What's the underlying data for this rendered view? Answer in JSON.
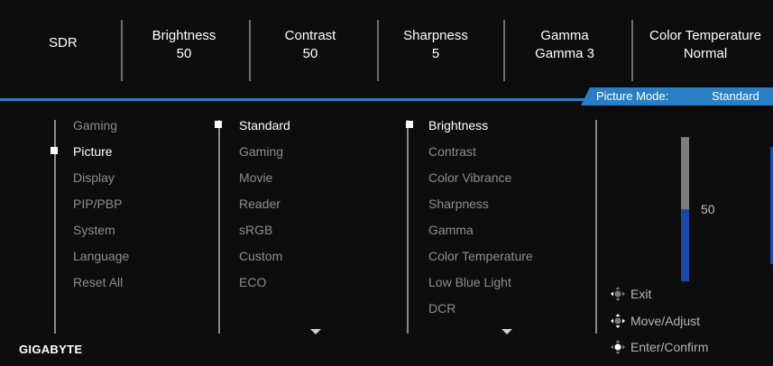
{
  "status_bar": {
    "hdr_mode": "SDR",
    "brightness": {
      "label": "Brightness",
      "value": "50"
    },
    "contrast": {
      "label": "Contrast",
      "value": "50"
    },
    "sharpness": {
      "label": "Sharpness",
      "value": "5"
    },
    "gamma": {
      "label": "Gamma",
      "value": "Gamma 3"
    },
    "color_temperature": {
      "label": "Color Temperature",
      "value": "Normal"
    }
  },
  "mode_tab": {
    "label": "Picture Mode:",
    "value": "Standard"
  },
  "main_menu": {
    "items": [
      "Gaming",
      "Picture",
      "Display",
      "PIP/PBP",
      "System",
      "Language",
      "Reset All"
    ],
    "active_index": 1
  },
  "picture_modes": {
    "items": [
      "Standard",
      "Gaming",
      "Movie",
      "Reader",
      "sRGB",
      "Custom",
      "ECO"
    ],
    "active_index": 0
  },
  "settings": {
    "items": [
      "Brightness",
      "Contrast",
      "Color Vibrance",
      "Sharpness",
      "Gamma",
      "Color Temperature",
      "Low Blue Light",
      "DCR"
    ],
    "active_index": 0
  },
  "slider": {
    "value": "50",
    "fraction": 0.5
  },
  "hints": [
    {
      "icon": "joystick-left-icon",
      "label": "Exit"
    },
    {
      "icon": "joystick-all-directions-icon",
      "label": "Move/Adjust"
    },
    {
      "icon": "joystick-press-icon",
      "label": "Enter/Confirm"
    }
  ],
  "brand": "GIGABYTE",
  "colors": {
    "accent": "#2a7fc4",
    "slider_fill": "#1d4aa8",
    "slider_track": "#7d7d7d",
    "background": "#0d0d0d"
  }
}
